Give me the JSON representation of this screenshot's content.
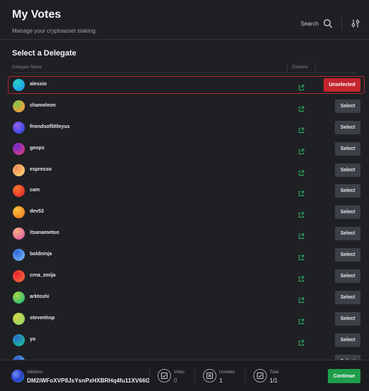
{
  "header": {
    "title": "My Votes",
    "subtitle": "Manage your cryptoasset staking.",
    "search_label": "Search"
  },
  "main": {
    "section_title": "Select a Delegate",
    "columns": {
      "name": "Delegate Name",
      "explorer": "Explorer"
    },
    "delegates": [
      {
        "name": "alessio",
        "action": "Unselected",
        "selected": true,
        "colors": [
          "#1ea3e8",
          "#27d3c9"
        ]
      },
      {
        "name": "chameleon",
        "action": "Select",
        "colors": [
          "#f0a13a",
          "#7ac74f"
        ]
      },
      {
        "name": "friendsoflittleyus",
        "action": "Select",
        "colors": [
          "#3b4de0",
          "#9a5cf0"
        ]
      },
      {
        "name": "geops",
        "action": "Select",
        "colors": [
          "#c83a8e",
          "#6e2bd0"
        ]
      },
      {
        "name": "espresso",
        "action": "Select",
        "colors": [
          "#f7c86a",
          "#f08a5d"
        ]
      },
      {
        "name": "cam",
        "action": "Select",
        "colors": [
          "#e8332f",
          "#f47a2c"
        ]
      },
      {
        "name": "dev52",
        "action": "Select",
        "colors": [
          "#f58a2a",
          "#f9c23c"
        ]
      },
      {
        "name": "itsanametoo",
        "action": "Select",
        "colors": [
          "#ea6aa0",
          "#f0b07a"
        ]
      },
      {
        "name": "boldninja",
        "action": "Select",
        "colors": [
          "#6aa8f0",
          "#2e64d8"
        ]
      },
      {
        "name": "crna_zmija",
        "action": "Select",
        "colors": [
          "#f25c3a",
          "#e8262f"
        ]
      },
      {
        "name": "arktoshi",
        "action": "Select",
        "colors": [
          "#3dc06a",
          "#a6d84a"
        ]
      },
      {
        "name": "stevenhop",
        "action": "Select",
        "colors": [
          "#9ed45c",
          "#d4d84a"
        ]
      },
      {
        "name": "yo",
        "action": "Select",
        "colors": [
          "#1ab3a0",
          "#2c6ad0"
        ]
      },
      {
        "name": "",
        "action": "Select",
        "colors": [
          "#4aa0e8",
          "#3a60c8"
        ]
      }
    ]
  },
  "footer": {
    "address_label": "Address",
    "address": "DM2iWFoXVP8JsYsnPxHXBRHq4fu11XV66G",
    "votes_label": "Votes",
    "votes_value": "0",
    "unvotes_label": "Unvotes",
    "unvotes_value": "1",
    "total_label": "Total",
    "total_value": "1/1",
    "continue_label": "Continue"
  },
  "colors": {
    "background": "#1f2024",
    "unselect_button": "#c4242d",
    "select_button": "#3b3f46",
    "continue_button": "#1f9d4a",
    "explorer_link": "#2fb56a"
  }
}
